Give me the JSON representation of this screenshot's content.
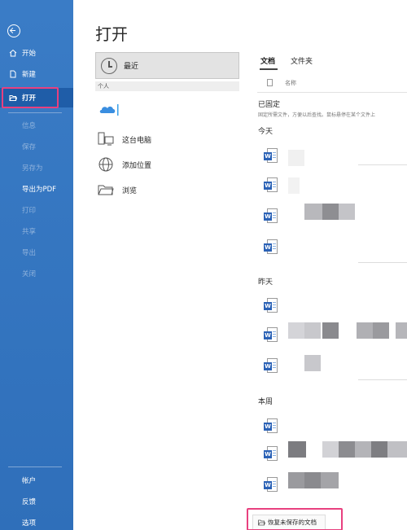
{
  "sidebar": {
    "top_items": [
      {
        "label": "开始",
        "icon": "home-icon"
      },
      {
        "label": "新建",
        "icon": "new-document-icon"
      },
      {
        "label": "打开",
        "icon": "open-folder-icon",
        "selected": true
      }
    ],
    "middle_items": [
      {
        "label": "信息",
        "enabled": false
      },
      {
        "label": "保存",
        "enabled": false
      },
      {
        "label": "另存为",
        "enabled": false
      },
      {
        "label": "导出为PDF",
        "enabled": true
      },
      {
        "label": "打印",
        "enabled": false
      },
      {
        "label": "共享",
        "enabled": false
      },
      {
        "label": "导出",
        "enabled": false
      },
      {
        "label": "关闭",
        "enabled": false
      }
    ],
    "bottom_items": [
      {
        "label": "帐户"
      },
      {
        "label": "反馈"
      },
      {
        "label": "选项"
      }
    ]
  },
  "page_title": "打开",
  "locations": {
    "recent": "最近",
    "section_personal": "个人",
    "items": [
      {
        "label": "这台电脑",
        "icon": "computer-icon"
      },
      {
        "label": "添加位置",
        "icon": "globe-icon"
      },
      {
        "label": "浏览",
        "icon": "folder-icon"
      }
    ]
  },
  "right_panel": {
    "tabs": [
      "文档",
      "文件夹"
    ],
    "column_name": "名称",
    "pinned_title": "已固定",
    "pinned_desc": "固定所需文件，方便以后查找。鼠标悬停在某个文件上",
    "groups": [
      {
        "title": "今天",
        "file_count": 4
      },
      {
        "title": "昨天",
        "file_count": 3
      },
      {
        "title": "本周",
        "file_count": 3
      }
    ],
    "recover_button": "恢复未保存的文档"
  },
  "colors": {
    "sidebar": "#2f6fba",
    "highlight": "#e8407f",
    "word_blue": "#2b62b6"
  }
}
